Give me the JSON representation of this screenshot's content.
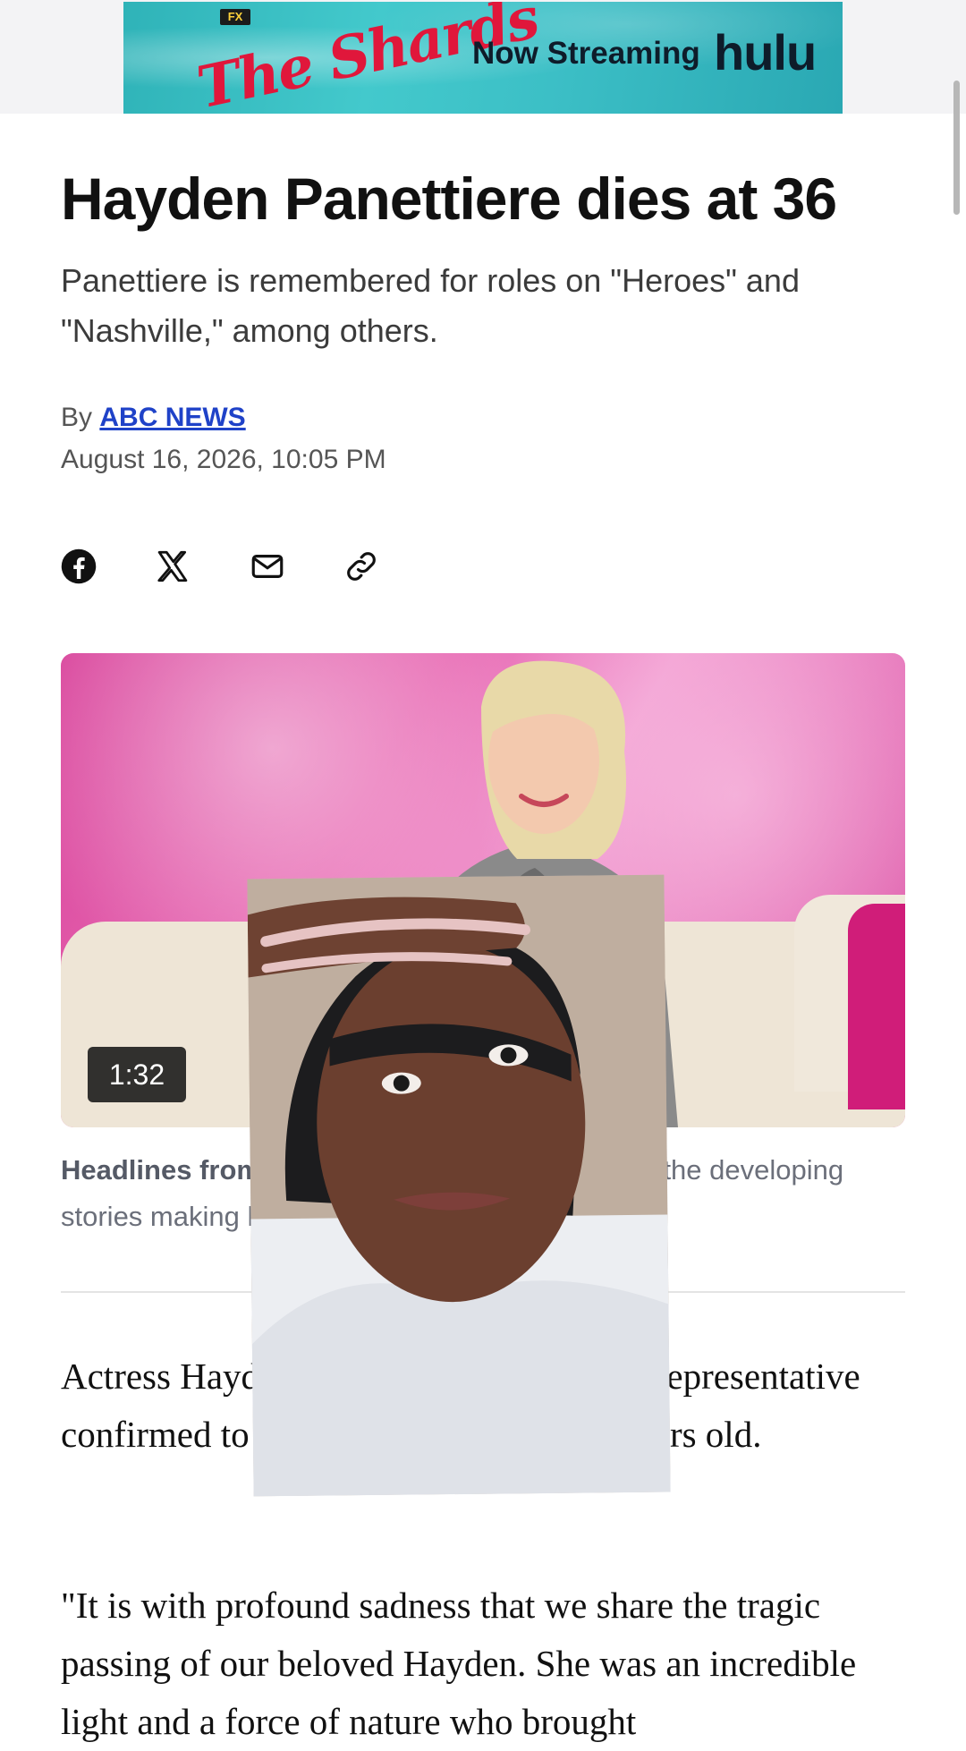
{
  "ad": {
    "network_badge": "FX",
    "show_title": "The Shards",
    "streaming_text": "Now Streaming",
    "service": "hulu"
  },
  "article": {
    "headline": "Hayden Panettiere dies at 36",
    "dek": "Panettiere is remembered for roles on \"Heroes\" and \"Nashville,\" among others.",
    "byline_prefix": "By",
    "author": "ABC NEWS",
    "date": "August 16, 2026, 10:05 PM"
  },
  "share": {
    "icons": [
      "facebook-icon",
      "x-icon",
      "mail-icon",
      "link-icon"
    ]
  },
  "video": {
    "duration": "1:32",
    "caption_bold": "Headlines from AB",
    "caption_text_right": "the developing",
    "caption_line2": "stories making headli"
  },
  "body": {
    "paragraph1": "Actress Hayden Panettiere has died, her representative confirmed to ABC News. She was 36 years old.",
    "paragraph2": "\"It is with profound sadness that we share the tragic passing of our beloved Hayden. She was an incredible light and a force of nature who brought"
  },
  "colors": {
    "link": "#1f42c8",
    "ad_background": "#3cbfc6",
    "ad_title": "#e0173b",
    "video_background": "#e86bb4"
  }
}
